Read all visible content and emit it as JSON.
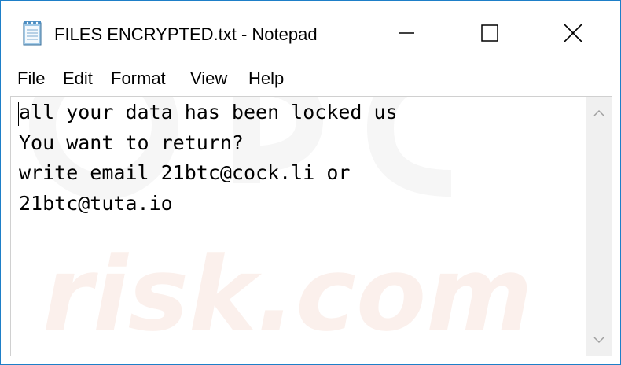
{
  "window": {
    "title": "FILES ENCRYPTED.txt - Notepad",
    "icon": "notepad-icon",
    "controls": {
      "minimize_icon": "minimize-icon",
      "maximize_icon": "maximize-icon",
      "close_icon": "close-icon"
    }
  },
  "menubar": {
    "items": [
      {
        "label": "File"
      },
      {
        "label": "Edit"
      },
      {
        "label": "Format"
      },
      {
        "label": "View"
      },
      {
        "label": "Help"
      }
    ]
  },
  "editor": {
    "lines": [
      "all your data has been locked us",
      "You want to return?",
      "write email 21btc@cock.li or",
      "21btc@tuta.io"
    ]
  },
  "watermark": {
    "text": "risk.com"
  },
  "colors": {
    "accent": "#1e7fc8",
    "text": "#000000",
    "scrollbar": "#f0f0f0"
  }
}
